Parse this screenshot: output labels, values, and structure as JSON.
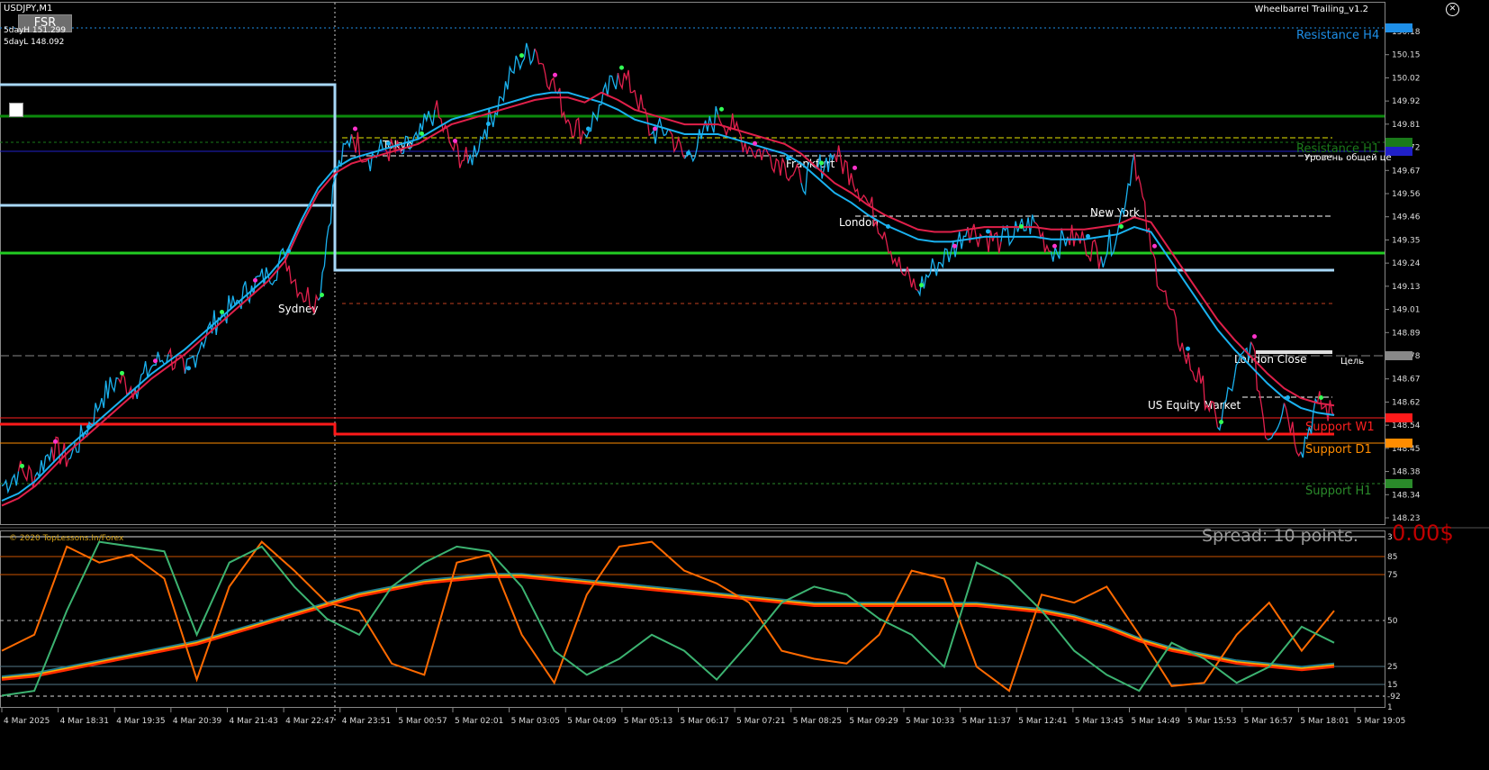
{
  "header": {
    "symbol": "USDJPY,M1",
    "fsr_button": "FSR",
    "five_day_high": "5dayH 151.299",
    "five_day_low": "5dayL 148.092",
    "ea_name": "Wheelbarrel Trailing_v1.2",
    "copyright": "© 2020 TopLessons.In/Forex"
  },
  "status": {
    "spread": "Spread: 10 points.",
    "profit": "0.00$"
  },
  "colors": {
    "price_up": "#1ab2f0",
    "price_down": "#e2204d",
    "ma": "#e0204a",
    "resistance": "#1e8fe8",
    "support_w1": "#ff1a1a",
    "support_d1": "#ff8c00",
    "support_h1": "#2a8a2a"
  },
  "price_scale": [
    "150.18",
    "150.15",
    "150.02",
    "149.92",
    "149.81",
    "149.72",
    "149.67",
    "149.56",
    "149.46",
    "149.35",
    "149.24",
    "149.13",
    "149.01",
    "148.89",
    "148.78",
    "148.67",
    "148.62",
    "148.54",
    "148.45",
    "148.38",
    "148.34",
    "148.23"
  ],
  "time_scale": [
    "4 Mar 2025",
    "4 Mar 18:31",
    "4 Mar 19:35",
    "4 Mar 20:39",
    "4 Mar 21:43",
    "4 Mar 22:47",
    "4 Mar 23:51",
    "5 Mar 00:57",
    "5 Mar 02:01",
    "5 Mar 03:05",
    "5 Mar 04:09",
    "5 Mar 05:13",
    "5 Mar 06:17",
    "5 Mar 07:21",
    "5 Mar 08:25",
    "5 Mar 09:29",
    "5 Mar 10:33",
    "5 Mar 11:37",
    "5 Mar 12:41",
    "5 Mar 13:45",
    "5 Mar 14:49",
    "5 Mar 15:53",
    "5 Mar 16:57",
    "5 Mar 18:01",
    "5 Mar 19:05"
  ],
  "level_labels": {
    "resistance_h4": "Resistance H4",
    "resistance_h1": "Resistance H1",
    "general_level": "Уровень общей це",
    "target": "Цель",
    "support_w1": "Support W1",
    "support_d1": "Support D1",
    "support_h1": "Support H1"
  },
  "session_labels": [
    "Sydney",
    "Tokyo",
    "Frankfurt",
    "London",
    "New York",
    "US Equity Market",
    "London Close"
  ],
  "oscillator_scale": [
    "3",
    "85",
    "75",
    "50",
    "25",
    "15",
    "-92",
    "1"
  ],
  "chart_data": {
    "type": "line",
    "ylim": [
      148.23,
      150.22
    ],
    "series": [
      {
        "values": [
          148.36,
          148.42,
          148.4,
          148.52,
          148.47,
          148.58,
          148.72,
          148.8,
          148.76,
          148.85,
          148.9,
          148.82,
          148.95,
          149.05,
          149.1,
          149.18,
          149.22,
          149.3,
          149.15,
          149.12,
          149.62,
          149.8,
          149.7,
          149.74,
          149.72,
          149.78,
          149.9,
          149.75,
          149.68,
          149.82,
          149.95,
          150.1,
          150.15,
          150.02,
          149.86,
          149.8,
          149.92,
          150.05,
          149.98,
          149.8,
          149.82,
          149.7,
          149.78,
          149.88,
          149.82,
          149.74,
          149.72,
          149.68,
          149.6,
          149.66,
          149.72,
          149.64,
          149.52,
          149.4,
          149.24,
          149.16,
          149.26,
          149.32,
          149.42,
          149.38,
          149.36,
          149.4,
          149.44,
          149.32,
          149.38,
          149.36,
          149.3,
          149.4,
          149.72,
          149.32,
          149.1,
          148.9,
          148.78,
          148.6,
          148.8,
          148.95,
          148.55,
          148.7,
          148.5,
          148.7,
          148.65
        ]
      },
      {
        "values": [
          148.3,
          148.33,
          148.38,
          148.45,
          148.52,
          148.58,
          148.64,
          148.7,
          148.76,
          148.82,
          148.87,
          148.92,
          148.98,
          149.04,
          149.1,
          149.16,
          149.22,
          149.3,
          149.45,
          149.58,
          149.66,
          149.7,
          149.72,
          149.74,
          149.76,
          149.78,
          149.82,
          149.86,
          149.88,
          149.9,
          149.92,
          149.94,
          149.96,
          149.97,
          149.97,
          149.95,
          149.93,
          149.9,
          149.86,
          149.84,
          149.82,
          149.8,
          149.8,
          149.8,
          149.78,
          149.76,
          149.74,
          149.72,
          149.68,
          149.62,
          149.56,
          149.52,
          149.47,
          149.43,
          149.4,
          149.37,
          149.36,
          149.36,
          149.37,
          149.38,
          149.38,
          149.38,
          149.38,
          149.37,
          149.37,
          149.37,
          149.38,
          149.39,
          149.42,
          149.4,
          149.3,
          149.2,
          149.1,
          149.0,
          148.92,
          148.85,
          148.78,
          148.72,
          148.68,
          148.66,
          148.65
        ]
      }
    ]
  }
}
